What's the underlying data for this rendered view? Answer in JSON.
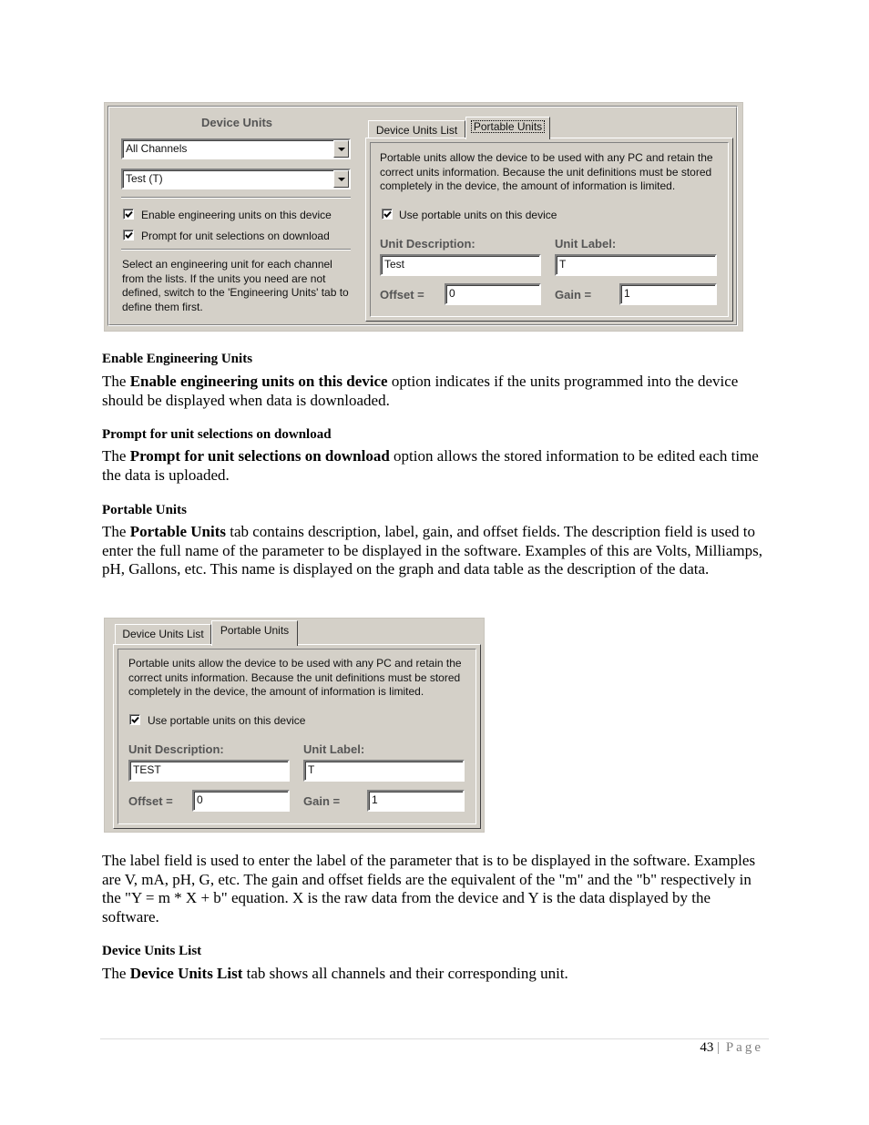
{
  "screenshot1": {
    "left_group": {
      "title": "Device Units",
      "channel_select": {
        "value": "All Channels"
      },
      "unit_select": {
        "value": "Test (T)"
      },
      "checkboxes": [
        {
          "label": "Enable engineering units on this device",
          "checked": true
        },
        {
          "label": "Prompt for unit selections on download",
          "checked": true
        }
      ],
      "help_text": "Select an engineering unit for each channel from the lists. If the units you need are not defined, switch to the 'Engineering Units' tab to define them first."
    },
    "tabs": [
      {
        "label": "Device Units List",
        "active": false
      },
      {
        "label": "Portable Units",
        "active": true
      }
    ],
    "portable": {
      "description": "Portable units allow the device to be used with any PC and retain the correct units information. Because the unit definitions must be stored completely in the device, the amount of information is limited.",
      "use_checkbox": {
        "label": "Use portable units on this device",
        "checked": true
      },
      "unit_description_label": "Unit Description:",
      "unit_description_value": "Test",
      "unit_label_label": "Unit Label:",
      "unit_label_value": "T",
      "offset_label": "Offset =",
      "offset_value": "0",
      "gain_label": "Gain =",
      "gain_value": "1"
    }
  },
  "sections": {
    "enable": {
      "heading": "Enable Engineering Units",
      "p_pre": "The ",
      "p_bold": "Enable engineering units on this device",
      "p_post": " option indicates if the units programmed into the device should be displayed when data is downloaded."
    },
    "prompt": {
      "heading": "Prompt for unit selections on download",
      "p_pre": "The ",
      "p_bold": "Prompt for unit selections on download",
      "p_post": " option allows the stored information to be edited each time the data is uploaded."
    },
    "portable": {
      "heading": "Portable Units",
      "p_pre": "The ",
      "p_bold": "Portable Units",
      "p_post": " tab contains description, label, gain, and offset fields. The description field is used to enter the full name of the parameter to be displayed in the software. Examples of this are Volts, Milliamps, pH, Gallons, etc. This name is displayed on the graph and data table as the description of the data."
    },
    "label_field": {
      "p": "The label field is used to enter the label of the parameter that is to be displayed in the software. Examples are V, mA, pH, G, etc. The gain and offset fields are the equivalent of the \"m\" and the \"b\" respectively in the \"Y = m * X + b\" equation. X is the raw data from the device and Y is the data displayed by the software."
    },
    "device_units_list": {
      "heading": "Device Units List",
      "p_pre": "The ",
      "p_bold": "Device Units List",
      "p_post": " tab shows all channels and their corresponding unit."
    }
  },
  "screenshot2": {
    "tabs": [
      {
        "label": "Device Units List",
        "active": false
      },
      {
        "label": "Portable Units",
        "active": true
      }
    ],
    "portable": {
      "description": "Portable units allow the device to be used with any PC and retain the correct units information. Because the unit definitions must be stored completely in the device, the amount of information is limited.",
      "use_checkbox": {
        "label": "Use portable units on this device",
        "checked": true
      },
      "unit_description_label": "Unit Description:",
      "unit_description_value": "TEST",
      "unit_label_label": "Unit Label:",
      "unit_label_value": "T",
      "offset_label": "Offset =",
      "offset_value": "0",
      "gain_label": "Gain =",
      "gain_value": "1"
    }
  },
  "footer": {
    "page_number": "43",
    "separator": "|",
    "page_word": "Page"
  }
}
